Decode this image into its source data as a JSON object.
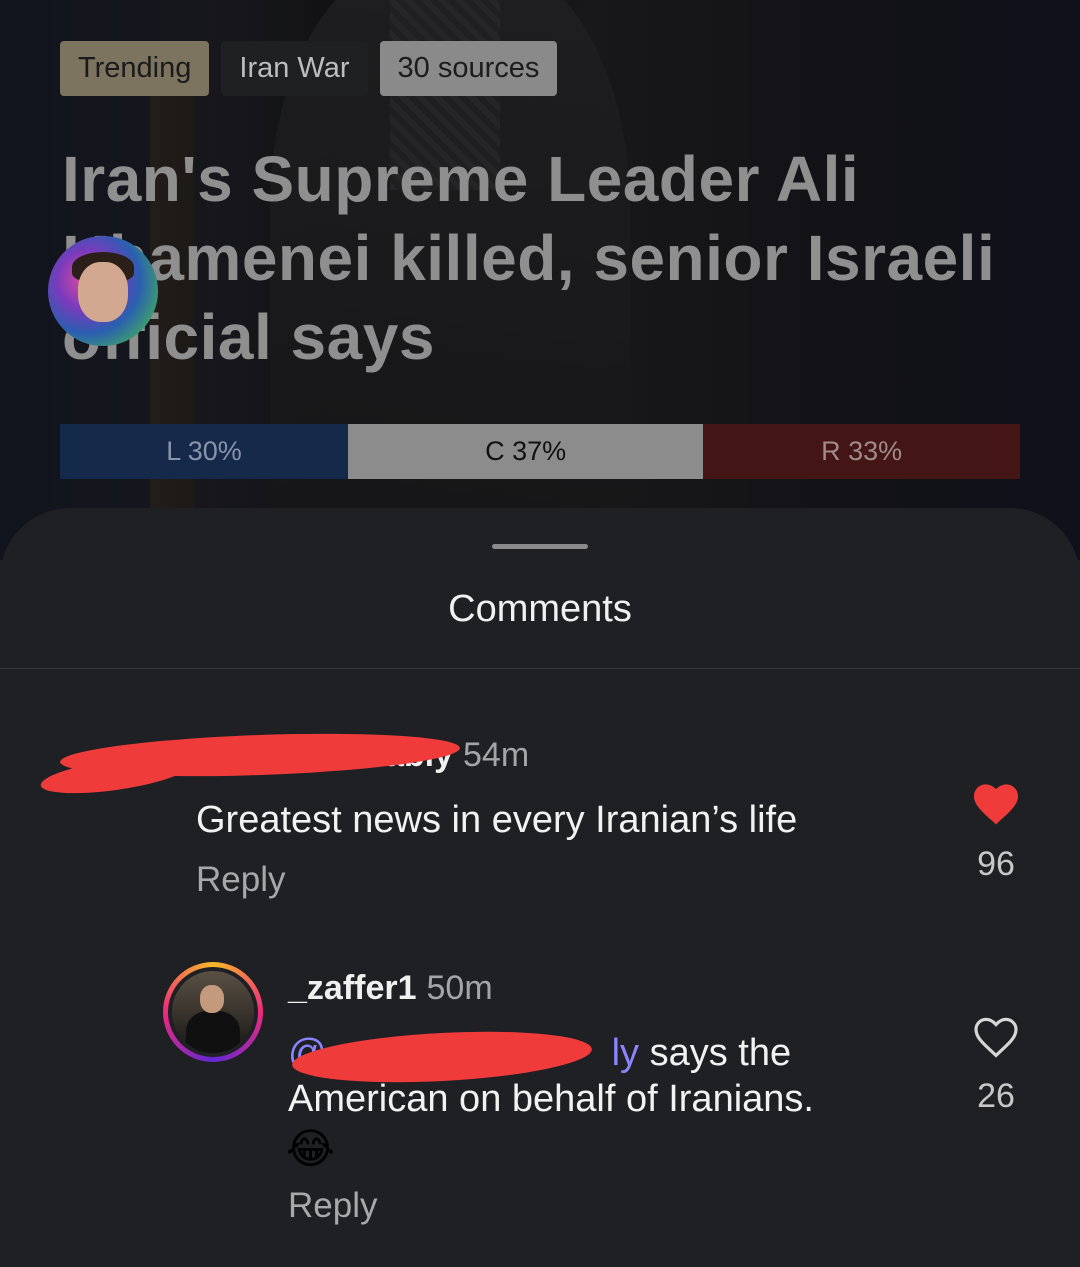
{
  "article": {
    "tags": {
      "trending": "Trending",
      "topic": "Iran War",
      "sources": "30 sources"
    },
    "headline": "Iran's Supreme Leader Ali Khamenei killed, senior Israeli official says",
    "bias": {
      "left_label": "L 30%",
      "center_label": "C 37%",
      "right_label": "R 33%",
      "left_pct": 30,
      "center_pct": 37,
      "right_pct": 33,
      "left_color": "#15294a",
      "center_color": "#8c8c8c",
      "right_color": "#431515"
    }
  },
  "comments_sheet": {
    "title": "Comments",
    "comments": [
      {
        "author_suffix": "ably",
        "time": "54m",
        "text": "Greatest news in every Iranian’s life",
        "reply_label": "Reply",
        "liked": true,
        "like_count": "96"
      },
      {
        "author": "_zaffer1",
        "time": "50m",
        "mention_start": "@",
        "mention_end": "ly",
        "text": " says the American on behalf of Iranians.",
        "emoji": "😂",
        "reply_label": "Reply",
        "liked": false,
        "like_count": "26"
      }
    ]
  },
  "colors": {
    "like_active": "#f03b3b",
    "mention": "#8a84ff",
    "redaction": "#f03b3b"
  }
}
